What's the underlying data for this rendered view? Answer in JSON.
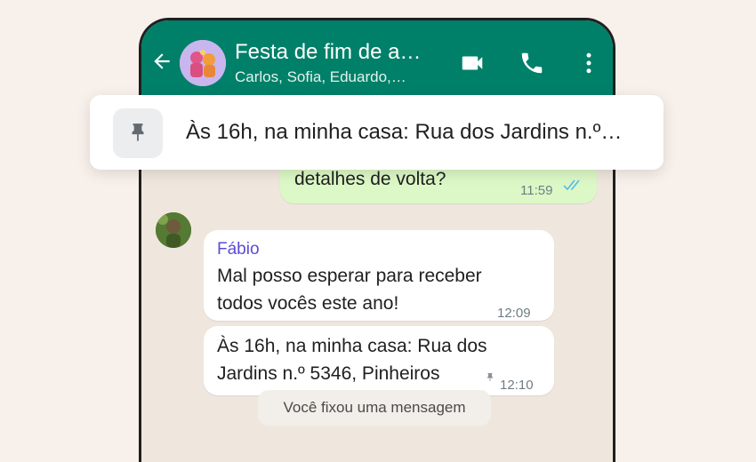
{
  "header": {
    "title": "Festa de fim de a…",
    "subtitle": "Carlos, Sofia, Eduardo,…"
  },
  "icons": {
    "back": "arrow-left-icon",
    "video": "video-call-icon",
    "phone": "phone-call-icon",
    "menu": "more-vert-icon",
    "pin": "pin-icon",
    "ticks": "double-check-icon"
  },
  "pinned": {
    "text": "Às 16h, na minha casa: Rua dos Jardins n.º…"
  },
  "messages": {
    "outgoing": {
      "text": "detalhes de volta?",
      "time": "11:59"
    },
    "fabio_1": {
      "sender": "Fábio",
      "line1": "Mal posso esperar para receber",
      "line2": "todos vocês este ano!",
      "time": "12:09"
    },
    "fabio_2": {
      "line1": "Às 16h, na minha casa: Rua dos",
      "line2": "Jardins n.º 5346, Pinheiros",
      "time": "12:10"
    }
  },
  "system": {
    "text": "Você fixou uma mensagem"
  },
  "colors": {
    "header": "#008069",
    "outgoing_bubble": "#dcf8c6",
    "sender_name": "#5b4bd6",
    "read_ticks": "#53bdeb",
    "page_background": "#f8f0ea"
  }
}
